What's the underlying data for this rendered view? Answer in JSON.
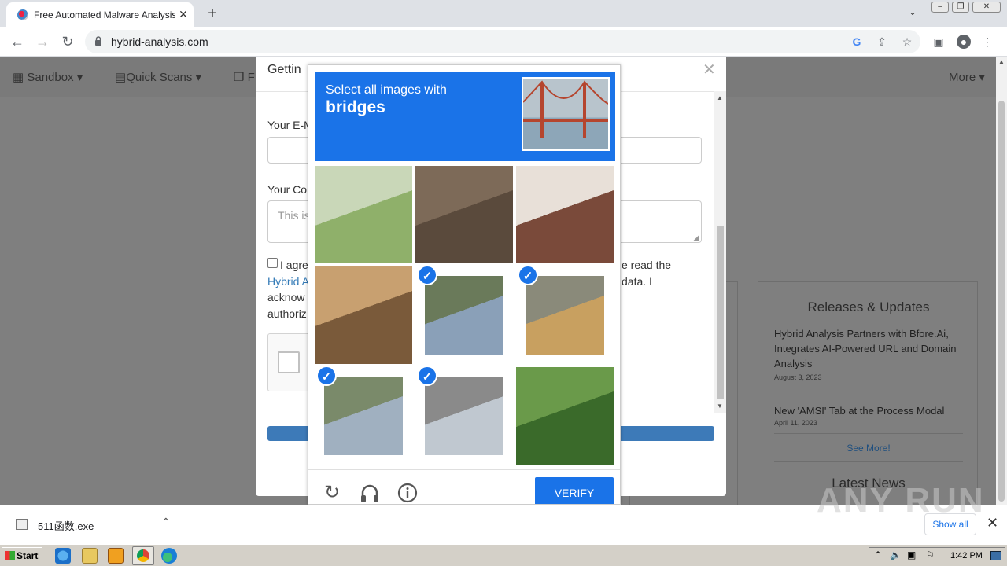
{
  "browser": {
    "tab_title": "Free Automated Malware Analysis Se",
    "url": "hybrid-analysis.com"
  },
  "site_nav": {
    "items": [
      "Sandbox",
      "Quick Scans",
      "F"
    ],
    "more": "More"
  },
  "modal": {
    "title": "Gettin",
    "email_label": "Your E-M",
    "comment_label": "Your Co",
    "comment_placeholder": "This is",
    "consent_left": [
      "I agre",
      "Hybrid A",
      "acknow",
      "authoriz"
    ],
    "consent_right": [
      "e read the",
      "data. I"
    ]
  },
  "challenge": {
    "prompt_line1": "Select all images with",
    "prompt_keyword": "bridges",
    "tiles": [
      {
        "selected": false,
        "colors": [
          "#8fb06a",
          "#c9d7b8"
        ]
      },
      {
        "selected": false,
        "colors": [
          "#5a4a3c",
          "#7d6a58"
        ]
      },
      {
        "selected": false,
        "colors": [
          "#7a4a3a",
          "#e8e0d8"
        ]
      },
      {
        "selected": false,
        "colors": [
          "#7a5a3a",
          "#c8a070"
        ]
      },
      {
        "selected": true,
        "colors": [
          "#8aa0b8",
          "#6a7a5a"
        ]
      },
      {
        "selected": true,
        "colors": [
          "#c8a060",
          "#8a8a7a"
        ]
      },
      {
        "selected": true,
        "colors": [
          "#a0b0c0",
          "#7a8a6a"
        ]
      },
      {
        "selected": true,
        "colors": [
          "#c0c8d0",
          "#8a8a8a"
        ]
      },
      {
        "selected": false,
        "colors": [
          "#3a6a2a",
          "#6a9a4a"
        ]
      }
    ],
    "verify_label": "VERIFY"
  },
  "side_panel": {
    "heading": "Releases & Updates",
    "news": [
      {
        "title": "Hybrid Analysis Partners with Bfore.Ai, Integrates AI-Powered URL and Domain Analysis",
        "date": "August 3, 2023"
      },
      {
        "title": "New 'AMSI' Tab at the Process Modal",
        "date": "April 11, 2023"
      }
    ],
    "see_more": "See More!",
    "latest_news": "Latest News"
  },
  "download": {
    "filename": "511函数.exe",
    "show_all": "Show all"
  },
  "watermark": "ANY RUN",
  "taskbar": {
    "start": "Start",
    "clock": "1:42 PM"
  },
  "icons": {
    "close": "✕",
    "plus": "+",
    "back": "←",
    "forward": "→",
    "reload": "↻",
    "check": "✓",
    "chevron_down": "⌄",
    "chevron_up": "⌃"
  }
}
